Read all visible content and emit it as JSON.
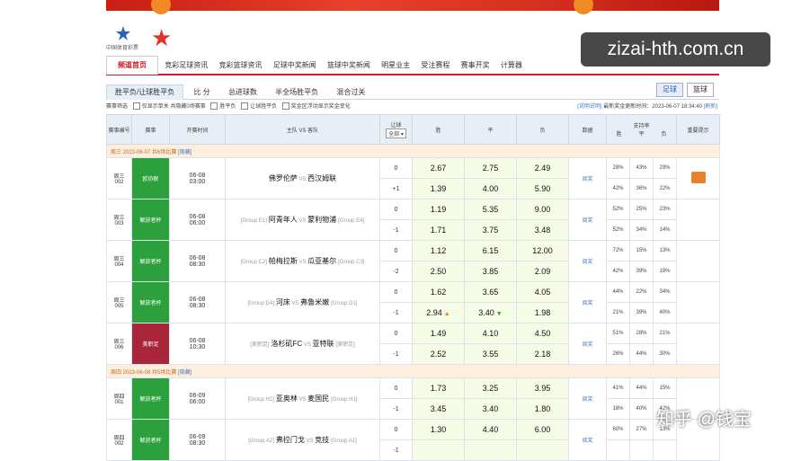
{
  "brand": {
    "logo_text": "中国体育彩票"
  },
  "nav": {
    "items": [
      "频道首页",
      "竞彩足球资讯",
      "竞彩篮球资讯",
      "足球中奖新闻",
      "篮球中奖新闻",
      "明星业主",
      "受注赛程",
      "赛事开奖",
      "计算器"
    ]
  },
  "watermark": "zizai-hth.com.cn",
  "tabs": [
    "胜平负/让球胜平负",
    "比 分",
    "总进球数",
    "半全场胜平负",
    "混合过关"
  ],
  "sport_tabs": [
    "足球",
    "篮球"
  ],
  "filters": {
    "label": "赛事筛选",
    "only_single": "仅显示单关",
    "hidden": "共隐藏0场赛事",
    "spf": "胜平负",
    "rq": "让球胜平负",
    "drift": "奖金区浮动显示奖金变化",
    "explain": "[说明说明]",
    "update": "最新奖金更新时间：2023-06-07 18:34:40",
    "refresh": "[刷新]"
  },
  "headers": {
    "no": "赛事编号",
    "league": "赛事",
    "time": "开赛时间",
    "teams": "主队 VS 客队",
    "handicap": "让球",
    "handicap_sel": "全部",
    "win": "胜",
    "draw": "平",
    "lose": "负",
    "data": "数据",
    "support": "支持率",
    "s_win": "胜",
    "s_draw": "平",
    "s_lose": "负",
    "tip": "重要提示"
  },
  "days": [
    {
      "label": "周三 2023-06-07  共6场比赛",
      "hide": "[隐藏]"
    },
    {
      "label": "周四 2023-06-08  共5场比赛",
      "hide": "[隐藏]"
    }
  ],
  "matches": [
    {
      "no": "周三\n002",
      "league": "欧协联",
      "color": "#2ca03c",
      "date": "06-08",
      "time": "03:00",
      "home_tag": "",
      "home": "佛罗伦萨",
      "away": "西汉姆联",
      "away_tag": "",
      "h": [
        "0",
        "+1"
      ],
      "win": [
        "2.67",
        "1.39"
      ],
      "draw": [
        "2.75",
        "4.00"
      ],
      "lose": [
        "2.49",
        "5.90"
      ],
      "link": "阅奖",
      "sw": [
        "28%",
        "42%"
      ],
      "sd": [
        "43%",
        "36%"
      ],
      "sl": [
        "29%",
        "22%"
      ],
      "gift": true
    },
    {
      "no": "周三\n003",
      "league": "解放者杯",
      "color": "#2ca03c",
      "date": "06-08",
      "time": "06:00",
      "home_tag": "[Group E1]",
      "home": "阿青年人",
      "away": "蒙利物浦",
      "away_tag": "[Group E4]",
      "h": [
        "0",
        "-1"
      ],
      "win": [
        "1.19",
        "1.71"
      ],
      "draw": [
        "5.35",
        "3.75"
      ],
      "lose": [
        "9.00",
        "3.48"
      ],
      "link": "阅奖",
      "sw": [
        "52%",
        "52%"
      ],
      "sd": [
        "25%",
        "34%"
      ],
      "sl": [
        "23%",
        "14%"
      ],
      "gift": false
    },
    {
      "no": "周三\n004",
      "league": "解放者杯",
      "color": "#2ca03c",
      "date": "06-08",
      "time": "08:30",
      "home_tag": "[Group C2]",
      "home": "帕梅拉斯",
      "away": "瓜亚基尔",
      "away_tag": "[Group C3]",
      "h": [
        "0",
        "-2"
      ],
      "win": [
        "1.12",
        "2.50"
      ],
      "draw": [
        "6.15",
        "3.85"
      ],
      "lose": [
        "12.00",
        "2.09"
      ],
      "link": "阅奖",
      "sw": [
        "72%",
        "42%"
      ],
      "sd": [
        "15%",
        "39%"
      ],
      "sl": [
        "13%",
        "19%"
      ],
      "gift": false
    },
    {
      "no": "周三\n005",
      "league": "解放者杯",
      "color": "#2ca03c",
      "date": "06-08",
      "time": "08:30",
      "home_tag": "[Group D4]",
      "home": "河床",
      "away": "弗鲁米嫩",
      "away_tag": "[Group D1]",
      "h": [
        "0",
        "-1"
      ],
      "win": [
        "1.62",
        "2.94"
      ],
      "draw": [
        "3.65",
        "3.40"
      ],
      "lose": [
        "4.05",
        "1.98"
      ],
      "link": "阅奖",
      "sw": [
        "44%",
        "21%"
      ],
      "sd": [
        "22%",
        "39%"
      ],
      "sl": [
        "34%",
        "40%"
      ],
      "gift": false,
      "win_arrow": "▲",
      "draw_arrow": "▼"
    },
    {
      "no": "周三\n006",
      "league": "美职足",
      "color": "#a8253a",
      "date": "06-08",
      "time": "10:30",
      "home_tag": "[美职足]",
      "home": "洛杉矶FC",
      "away": "亚特联",
      "away_tag": "[美职足]",
      "h": [
        "0",
        "-1"
      ],
      "win": [
        "1.49",
        "2.52"
      ],
      "draw": [
        "4.10",
        "3.55"
      ],
      "lose": [
        "4.50",
        "2.18"
      ],
      "link": "阅奖",
      "sw": [
        "51%",
        "26%"
      ],
      "sd": [
        "28%",
        "44%"
      ],
      "sl": [
        "21%",
        "30%"
      ],
      "gift": false
    },
    {
      "no": "周四\n001",
      "league": "解放者杯",
      "color": "#2ca03c",
      "date": "06-09",
      "time": "06:00",
      "home_tag": "[Group H2]",
      "home": "亚奥林",
      "away": "麦国民",
      "away_tag": "[Group H1]",
      "h": [
        "0",
        "-1"
      ],
      "win": [
        "1.73",
        "3.45"
      ],
      "draw": [
        "3.25",
        "3.40"
      ],
      "lose": [
        "3.95",
        "1.80"
      ],
      "link": "阅奖",
      "sw": [
        "41%",
        "18%"
      ],
      "sd": [
        "44%",
        "40%"
      ],
      "sl": [
        "15%",
        "42%"
      ],
      "gift": false
    },
    {
      "no": "周四\n002",
      "league": "解放者杯",
      "color": "#2ca03c",
      "date": "06-09",
      "time": "08:30",
      "home_tag": "[Group A2]",
      "home": "弗拉门戈",
      "away": "竞技",
      "away_tag": "[Group A1]",
      "h": [
        "0",
        "-1"
      ],
      "win": [
        "1.30",
        ""
      ],
      "draw": [
        "4.40",
        ""
      ],
      "lose": [
        "6.00",
        ""
      ],
      "link": "阅奖",
      "sw": [
        "60%",
        ""
      ],
      "sd": [
        "27%",
        ""
      ],
      "sl": [
        "13%",
        ""
      ],
      "gift": false
    }
  ],
  "zhihu": "知乎 @钱宝"
}
